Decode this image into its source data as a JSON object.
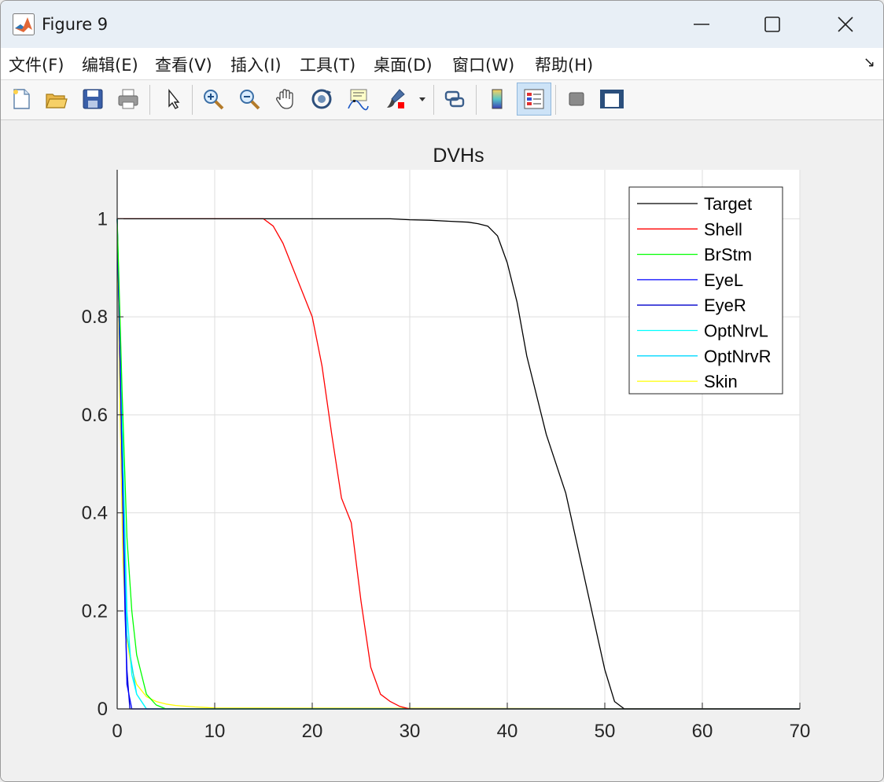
{
  "window": {
    "title": "Figure 9",
    "icon": "matlab-icon",
    "controls": [
      "minimize-icon",
      "maximize-icon",
      "close-icon"
    ]
  },
  "menu": {
    "items": [
      "文件(F)",
      "编辑(E)",
      "查看(V)",
      "插入(I)",
      "工具(T)",
      "桌面(D)",
      "窗口(W)",
      "帮助(H)"
    ],
    "dock_arrow": "↘"
  },
  "toolbar": {
    "buttons": [
      "new-file-icon",
      "open-folder-icon",
      "save-icon",
      "print-icon",
      "pointer-icon",
      "zoom-in-icon",
      "zoom-out-icon",
      "pan-hand-icon",
      "rotate-3d-icon",
      "data-cursor-icon",
      "brush-icon",
      "link-icon",
      "colorbar-icon",
      "legend-icon",
      "hide-tools-icon",
      "show-tools-icon"
    ],
    "active": "legend-icon"
  },
  "chart_data": {
    "type": "line",
    "title": "DVHs",
    "xlabel": "",
    "ylabel": "",
    "xlim": [
      0,
      70
    ],
    "ylim": [
      0,
      1.1
    ],
    "xticks": [
      0,
      10,
      20,
      30,
      40,
      50,
      60,
      70
    ],
    "yticks": [
      0,
      0.2,
      0.4,
      0.6,
      0.8,
      1
    ],
    "xtick_labels": [
      "0",
      "10",
      "20",
      "30",
      "40",
      "50",
      "60",
      "70"
    ],
    "ytick_labels": [
      "0",
      "0.2",
      "0.4",
      "0.6",
      "0.8",
      "1"
    ],
    "grid": true,
    "legend_position": "top-right",
    "series": [
      {
        "name": "Target",
        "color": "#000000",
        "x": [
          0,
          28,
          30,
          32,
          34,
          36,
          37,
          38,
          39,
          40,
          41,
          42,
          44,
          46,
          48,
          50,
          51,
          52,
          70
        ],
        "y": [
          1,
          1,
          0.998,
          0.997,
          0.995,
          0.993,
          0.99,
          0.985,
          0.965,
          0.91,
          0.83,
          0.72,
          0.56,
          0.44,
          0.26,
          0.08,
          0.015,
          0,
          0
        ]
      },
      {
        "name": "Shell",
        "color": "#ff0000",
        "x": [
          0,
          15,
          16,
          17,
          18,
          19,
          20,
          21,
          22,
          23,
          24,
          25,
          26,
          27,
          28,
          29,
          30,
          70
        ],
        "y": [
          1,
          1,
          0.985,
          0.95,
          0.9,
          0.85,
          0.8,
          0.7,
          0.56,
          0.43,
          0.38,
          0.22,
          0.085,
          0.03,
          0.015,
          0.005,
          0,
          0
        ]
      },
      {
        "name": "BrStm",
        "color": "#00ff00",
        "x": [
          0,
          0.5,
          1,
          1.5,
          2,
          3,
          4,
          5,
          70
        ],
        "y": [
          1,
          0.65,
          0.35,
          0.2,
          0.11,
          0.03,
          0.008,
          0,
          0
        ]
      },
      {
        "name": "EyeL",
        "color": "#0000ff",
        "x": [
          0,
          0.5,
          1,
          1.5,
          70
        ],
        "y": [
          1,
          0.5,
          0.05,
          0,
          0
        ]
      },
      {
        "name": "EyeR",
        "color": "#0000cc",
        "x": [
          0,
          0.4,
          0.8,
          1,
          1.3,
          70
        ],
        "y": [
          1,
          0.6,
          0.2,
          0.08,
          0,
          0
        ]
      },
      {
        "name": "OptNrvL",
        "color": "#00ffff",
        "x": [
          0,
          0.5,
          1,
          1.5,
          2,
          3,
          70
        ],
        "y": [
          1,
          0.6,
          0.2,
          0.07,
          0.03,
          0,
          0
        ]
      },
      {
        "name": "OptNrvR",
        "color": "#00d8ff",
        "x": [
          0,
          0.5,
          1,
          2,
          3,
          70
        ],
        "y": [
          1,
          0.55,
          0.15,
          0.03,
          0,
          0
        ]
      },
      {
        "name": "Skin",
        "color": "#ffff00",
        "x": [
          0,
          0.3,
          0.6,
          1,
          1.5,
          2,
          3,
          4,
          5,
          6,
          8,
          10,
          70
        ],
        "y": [
          1,
          0.6,
          0.3,
          0.14,
          0.08,
          0.05,
          0.025,
          0.015,
          0.01,
          0.007,
          0.004,
          0.002,
          0
        ]
      }
    ]
  }
}
